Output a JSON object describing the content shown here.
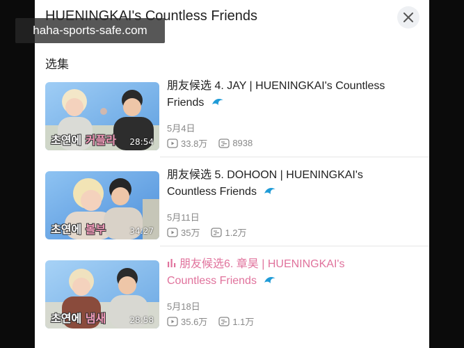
{
  "header": {
    "title": "HUENINGKAI's Countless Friends"
  },
  "section_label": "选集",
  "episodes": [
    {
      "title_line1": "朋友候选 4. JAY | HUENINGKAI's Countless",
      "title_line2": "Friends",
      "date": "5月4日",
      "views": "33.8万",
      "danmaku": "8938",
      "duration": "28:54",
      "caption_a": "초연에",
      "caption_b": "커플라",
      "playing": false
    },
    {
      "title_line1": "朋友候选 5. DOHOON | HUENINGKAI's",
      "title_line2": "Countless Friends",
      "date": "5月11日",
      "views": "35万",
      "danmaku": "1.2万",
      "duration": "34:27",
      "caption_a": "초연에",
      "caption_b": "볼부",
      "playing": false
    },
    {
      "title_line1": "朋友候选6. 章昊 | HUENINGKAI's",
      "title_line2": "Countless Friends",
      "date": "5月18日",
      "views": "35.6万",
      "danmaku": "1.1万",
      "duration": "28:58",
      "caption_a": "초연에",
      "caption_b": "냄새",
      "playing": true
    }
  ],
  "watermark": "haha-sports-safe.com",
  "colors": {
    "accent_pink": "#e0729c",
    "wave_blue": "#1f9bd7"
  },
  "icons": [
    "close-icon",
    "wave-icon",
    "play-count-icon",
    "danmaku-icon",
    "now-playing-icon"
  ]
}
